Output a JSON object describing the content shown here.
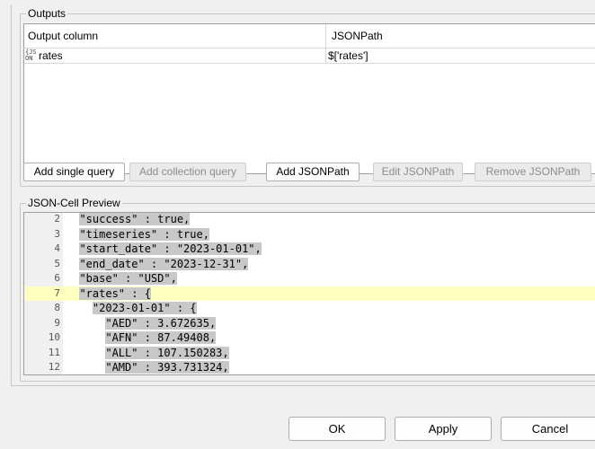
{
  "outputs": {
    "title": "Outputs",
    "columns": [
      "Output column",
      "JSONPath"
    ],
    "rows": [
      {
        "icon": "json-icon",
        "icon_text": "{JS\nON",
        "column": "rates",
        "path": "$['rates']"
      }
    ],
    "buttons": {
      "add_single": "Add single query",
      "add_collection": "Add collection query",
      "add_jsonpath": "Add JSONPath",
      "edit_jsonpath": "Edit JSONPath",
      "remove_jsonpath": "Remove JSONPath"
    }
  },
  "preview": {
    "title": "JSON-Cell Preview",
    "lines": [
      {
        "num": "2",
        "text": "  \"success\" : true,"
      },
      {
        "num": "3",
        "text": "  \"timeseries\" : true,"
      },
      {
        "num": "4",
        "text": "  \"start_date\" : \"2023-01-01\","
      },
      {
        "num": "5",
        "text": "  \"end_date\" : \"2023-12-31\","
      },
      {
        "num": "6",
        "text": "  \"base\" : \"USD\","
      },
      {
        "num": "7",
        "text": "  \"rates\" : {"
      },
      {
        "num": "8",
        "text": "    \"2023-01-01\" : {"
      },
      {
        "num": "9",
        "text": "      \"AED\" : 3.672635,"
      },
      {
        "num": "10",
        "text": "      \"AFN\" : 87.49408,"
      },
      {
        "num": "11",
        "text": "      \"ALL\" : 107.150283,"
      },
      {
        "num": "12",
        "text": "      \"AMD\" : 393.731324,"
      }
    ],
    "current_line": "7"
  },
  "dialog": {
    "ok": "OK",
    "apply": "Apply",
    "cancel": "Cancel"
  }
}
